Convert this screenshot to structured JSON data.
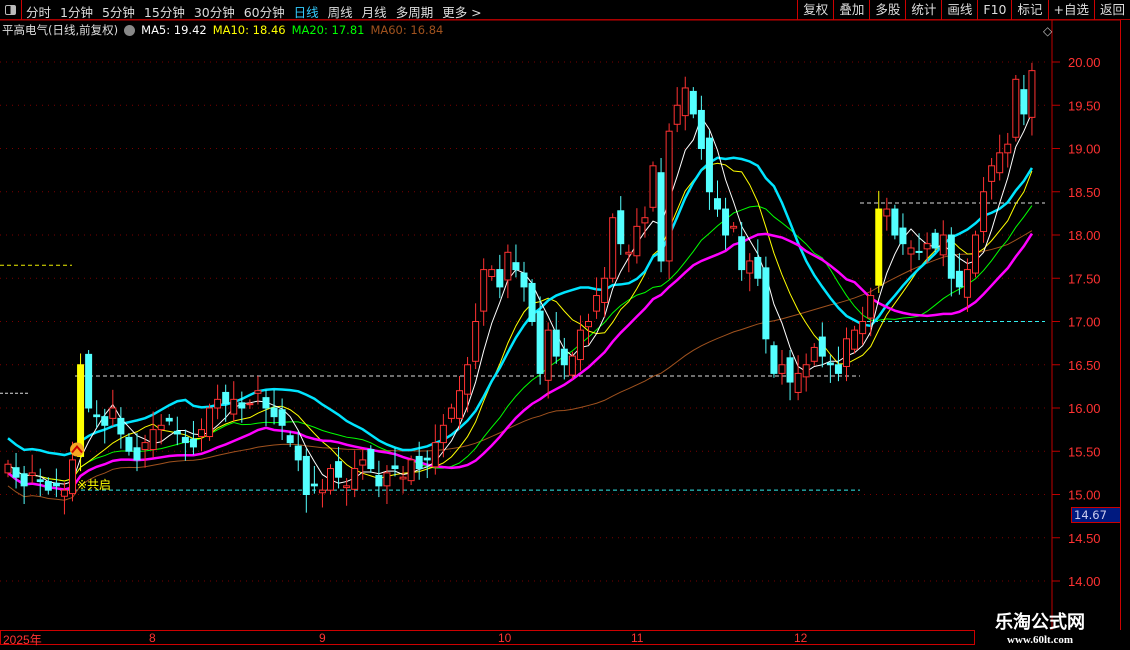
{
  "toolbar": {
    "periods": [
      "分时",
      "1分钟",
      "5分钟",
      "15分钟",
      "30分钟",
      "60分钟",
      "日线",
      "周线",
      "月线",
      "多周期",
      "更多 >"
    ],
    "active_period": "日线",
    "tools": [
      "复权",
      "叠加",
      "多股",
      "统计",
      "画线",
      "F10",
      "标记",
      "+自选",
      "返回"
    ]
  },
  "legend": {
    "stock": "平高电气(日线,前复权)",
    "ma5": "MA5: 19.42",
    "ma10": "MA10: 18.46",
    "ma20": "MA20: 17.81",
    "ma60": "MA60: 16.84"
  },
  "colors": {
    "up": "#ff3232",
    "down": "#54ffff",
    "ma5": "#ffffff",
    "ma10": "#ffff00",
    "ma20": "#00ff00",
    "ma60": "#a0521e",
    "line_magenta": "#ff00ff",
    "line_cyan": "#00e5ff",
    "axis": "#c00000"
  },
  "price_tag": "14.67",
  "signal_label": "※共启",
  "date_axis": [
    "2025年",
    "8",
    "9",
    "10",
    "11",
    "12"
  ],
  "watermark": {
    "title": "乐淘公式网",
    "url": "www.60lt.com"
  },
  "chart_data": {
    "type": "candlestick",
    "ylim": [
      13.6,
      20.4
    ],
    "yticks": [
      "20.00",
      "19.50",
      "19.00",
      "18.50",
      "18.00",
      "17.50",
      "17.00",
      "16.50",
      "16.00",
      "15.50",
      "15.00",
      "14.50",
      "14.00"
    ],
    "closes": [
      15.35,
      15.2,
      15.1,
      15.25,
      15.15,
      15.05,
      15.1,
      15.05,
      15.4,
      16.5,
      16.0,
      15.9,
      15.8,
      16.0,
      15.7,
      15.5,
      15.4,
      15.6,
      15.75,
      15.8,
      15.85,
      15.7,
      15.6,
      15.55,
      15.75,
      16.0,
      16.1,
      16.05,
      16.1,
      16.0,
      16.05,
      16.2,
      16.0,
      15.9,
      15.8,
      15.6,
      15.4,
      15.0,
      15.1,
      15.05,
      15.3,
      15.2,
      15.1,
      15.3,
      15.4,
      15.3,
      15.1,
      15.25,
      15.3,
      15.2,
      15.4,
      15.3,
      15.4,
      15.6,
      15.8,
      16.0,
      16.2,
      16.5,
      17.0,
      17.6,
      17.6,
      17.4,
      17.8,
      17.6,
      17.4,
      17.0,
      16.4,
      16.9,
      16.6,
      16.5,
      16.6,
      16.9,
      17.0,
      17.3,
      17.5,
      18.2,
      17.9,
      17.8,
      18.1,
      18.2,
      18.8,
      17.7,
      19.2,
      19.5,
      19.7,
      19.4,
      19.0,
      18.5,
      18.3,
      18.0,
      18.1,
      17.6,
      17.7,
      17.5,
      16.8,
      16.4,
      16.5,
      16.3,
      16.4,
      16.5,
      16.7,
      16.6,
      16.5,
      16.4,
      16.8,
      16.9,
      17.0,
      17.3,
      18.3,
      18.3,
      18.0,
      17.9,
      17.85,
      17.8,
      17.9,
      17.85,
      18.0,
      17.5,
      17.4,
      17.6,
      18.0,
      18.5,
      18.8,
      18.95,
      19.05,
      19.8,
      19.4,
      19.9
    ],
    "highlight_days": [
      9,
      108
    ],
    "levels": [
      {
        "price": 16.37,
        "color": "white"
      },
      {
        "price": 15.05,
        "color": "cyan"
      },
      {
        "price": 17.0,
        "color": "cyan"
      },
      {
        "price": 18.37,
        "color": "white"
      },
      {
        "price": 17.65,
        "color": "yellow"
      }
    ]
  }
}
